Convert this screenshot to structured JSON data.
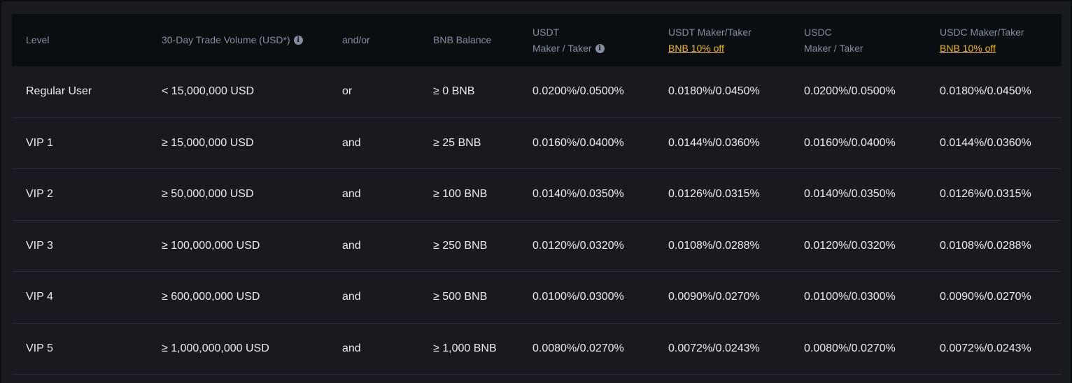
{
  "header": {
    "level": "Level",
    "volume": "30-Day Trade Volume (USD*)",
    "andor": "and/or",
    "bnb_balance": "BNB Balance",
    "usdt_line1": "USDT",
    "usdt_line2": "Maker / Taker",
    "usdt_bnb_line1": "USDT Maker/Taker",
    "usdt_bnb_link": "BNB 10% off",
    "usdc_line1": "USDC",
    "usdc_line2": "Maker / Taker",
    "usdc_bnb_line1": "USDC Maker/Taker",
    "usdc_bnb_link": "BNB 10% off",
    "info_icon": "info-icon"
  },
  "rows": [
    {
      "level": "Regular User",
      "volume": "< 15,000,000 USD",
      "andor": "or",
      "bnb": "≥ 0 BNB",
      "usdt": "0.0200%/0.0500%",
      "usdt_bnb": "0.0180%/0.0450%",
      "usdc": "0.0200%/0.0500%",
      "usdc_bnb": "0.0180%/0.0450%"
    },
    {
      "level": "VIP 1",
      "volume": "≥ 15,000,000 USD",
      "andor": "and",
      "bnb": "≥ 25 BNB",
      "usdt": "0.0160%/0.0400%",
      "usdt_bnb": "0.0144%/0.0360%",
      "usdc": "0.0160%/0.0400%",
      "usdc_bnb": "0.0144%/0.0360%"
    },
    {
      "level": "VIP 2",
      "volume": "≥ 50,000,000 USD",
      "andor": "and",
      "bnb": "≥ 100 BNB",
      "usdt": "0.0140%/0.0350%",
      "usdt_bnb": "0.0126%/0.0315%",
      "usdc": "0.0140%/0.0350%",
      "usdc_bnb": "0.0126%/0.0315%"
    },
    {
      "level": "VIP 3",
      "volume": "≥ 100,000,000 USD",
      "andor": "and",
      "bnb": "≥ 250 BNB",
      "usdt": "0.0120%/0.0320%",
      "usdt_bnb": "0.0108%/0.0288%",
      "usdc": "0.0120%/0.0320%",
      "usdc_bnb": "0.0108%/0.0288%"
    },
    {
      "level": "VIP 4",
      "volume": "≥ 600,000,000 USD",
      "andor": "and",
      "bnb": "≥ 500 BNB",
      "usdt": "0.0100%/0.0300%",
      "usdt_bnb": "0.0090%/0.0270%",
      "usdc": "0.0100%/0.0300%",
      "usdc_bnb": "0.0090%/0.0270%"
    },
    {
      "level": "VIP 5",
      "volume": "≥ 1,000,000,000 USD",
      "andor": "and",
      "bnb": "≥ 1,000 BNB",
      "usdt": "0.0080%/0.0270%",
      "usdt_bnb": "0.0072%/0.0243%",
      "usdc": "0.0080%/0.0270%",
      "usdc_bnb": "0.0072%/0.0243%"
    }
  ]
}
